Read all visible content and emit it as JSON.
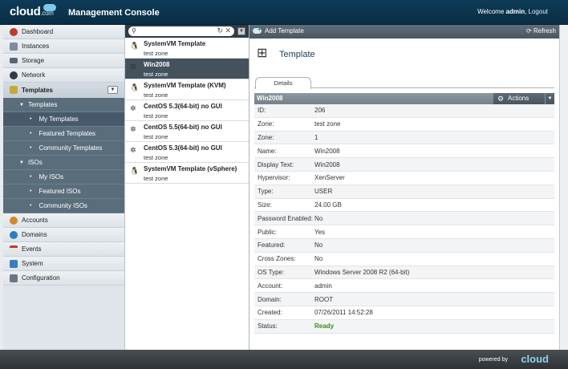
{
  "header": {
    "logo": "cloud",
    "logo_suffix": ".com",
    "title": "Management Console",
    "welcome_prefix": "Welcome",
    "username": "admin",
    "logout": "Logout"
  },
  "sidebar": {
    "dashboard": "Dashboard",
    "instances": "Instances",
    "storage": "Storage",
    "network": "Network",
    "templates": "Templates",
    "templates_sub": "Templates",
    "my_templates": "My Templates",
    "featured_templates": "Featured Templates",
    "community_templates": "Community Templates",
    "isos": "ISOs",
    "my_isos": "My ISOs",
    "featured_isos": "Featured ISOs",
    "community_isos": "Community ISOs",
    "accounts": "Accounts",
    "domains": "Domains",
    "events": "Events",
    "system": "System",
    "configuration": "Configuration"
  },
  "list": {
    "items": [
      {
        "name": "SystemVM Template",
        "zone": "test zone"
      },
      {
        "name": "Win2008",
        "zone": "test zone"
      },
      {
        "name": "SystemVM Template (KVM)",
        "zone": "test zone"
      },
      {
        "name": "CentOS 5.3(64-bit) no GUI",
        "zone": "test zone"
      },
      {
        "name": "CentOS 5.5(64-bit) no GUI",
        "zone": "test zone"
      },
      {
        "name": "CentOS 5.3(64-bit) no GUI",
        "zone": "test zone"
      },
      {
        "name": "SystemVM Template (vSphere)",
        "zone": "test zone"
      }
    ]
  },
  "toolbar": {
    "add_template": "Add Template",
    "refresh": "Refresh"
  },
  "detail": {
    "title": "Template",
    "tab_details": "Details",
    "header": "Win2008",
    "actions": "Actions",
    "rows": [
      {
        "key": "ID:",
        "value": "206"
      },
      {
        "key": "Zone:",
        "value": "test zone"
      },
      {
        "key": "Zone:",
        "value": "1"
      },
      {
        "key": "Name:",
        "value": "Win2008"
      },
      {
        "key": "Display Text:",
        "value": "Win2008"
      },
      {
        "key": "Hypervisor:",
        "value": "XenServer"
      },
      {
        "key": "Type:",
        "value": "USER"
      },
      {
        "key": "Size:",
        "value": "24.00 GB"
      },
      {
        "key": "Password Enabled:",
        "value": "No"
      },
      {
        "key": "Public:",
        "value": "Yes"
      },
      {
        "key": "Featured:",
        "value": "No"
      },
      {
        "key": "Cross Zones:",
        "value": "No"
      },
      {
        "key": "OS Type:",
        "value": "Windows Server 2008 R2 (64-bit)"
      },
      {
        "key": "Account:",
        "value": "admin"
      },
      {
        "key": "Domain:",
        "value": "ROOT"
      },
      {
        "key": "Created:",
        "value": "07/26/2011 14:52:28"
      },
      {
        "key": "Status:",
        "value": "Ready"
      }
    ]
  },
  "footer": {
    "powered_by": "powered by",
    "logo": "cloud"
  },
  "colors": {
    "header_bg": "#0d3b57",
    "selected_row": "#44525e",
    "status_ready": "#3a8a17"
  }
}
